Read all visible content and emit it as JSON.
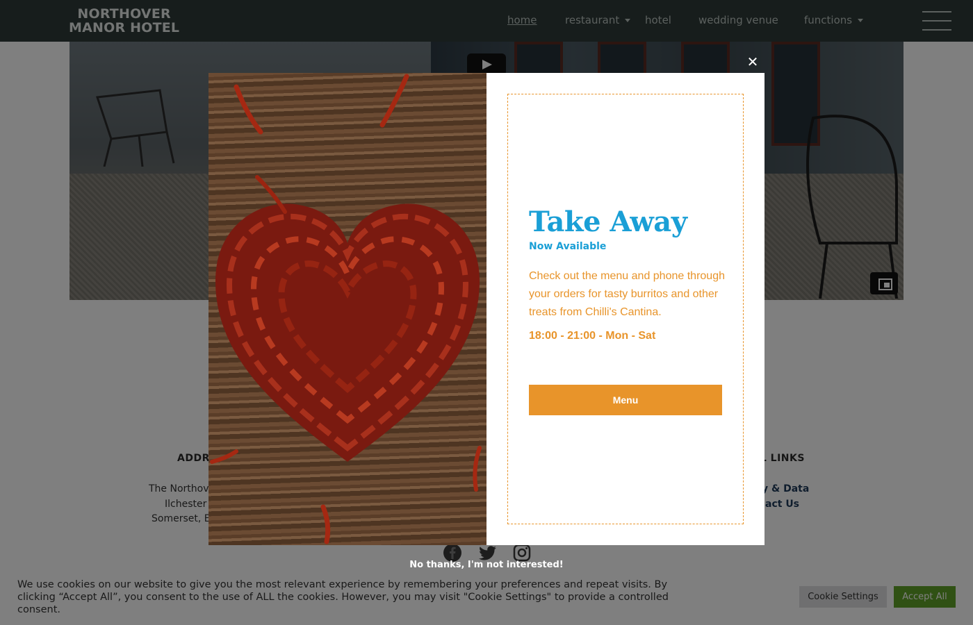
{
  "header": {
    "logo_line1": "NORTHOVER",
    "logo_line2": "MANOR HOTEL",
    "nav": [
      {
        "label": "home"
      },
      {
        "label": "restaurant"
      },
      {
        "label": "hotel"
      },
      {
        "label": "wedding venue"
      },
      {
        "label": "functions"
      }
    ]
  },
  "footer": {
    "address_heading": "ADDR",
    "address_line1": "The Northov",
    "address_line2": "Ilchester",
    "address_line3": "Somerset, E",
    "links_heading": "UL LINKS",
    "link1": "y & Data",
    "link2": "act Us",
    "social_icons": [
      "facebook-icon",
      "twitter-icon",
      "instagram-icon"
    ]
  },
  "popup": {
    "title": "Take Away",
    "subtitle": "Now Available",
    "description": "Check out the menu and phone through your orders for tasty burritos and other treats from Chilli's Cantina.",
    "hours": "18:00 - 21:00 - Mon - Sat",
    "menu_button": "Menu",
    "close_symbol": "✕",
    "dismiss": "No thanks, I'm not interested!"
  },
  "cookie": {
    "text": "We use cookies on our website to give you the most relevant experience by remembering your preferences and repeat visits. By clicking “Accept All”, you consent to the use of ALL the cookies. However, you may visit \"Cookie Settings\" to provide a controlled consent.",
    "settings_button": "Cookie Settings",
    "accept_button": "Accept All"
  },
  "colors": {
    "header_bg": "#2f3b38",
    "popup_accent": "#e8942a",
    "popup_title": "#1a9fd6",
    "accept_green": "#61a229"
  }
}
